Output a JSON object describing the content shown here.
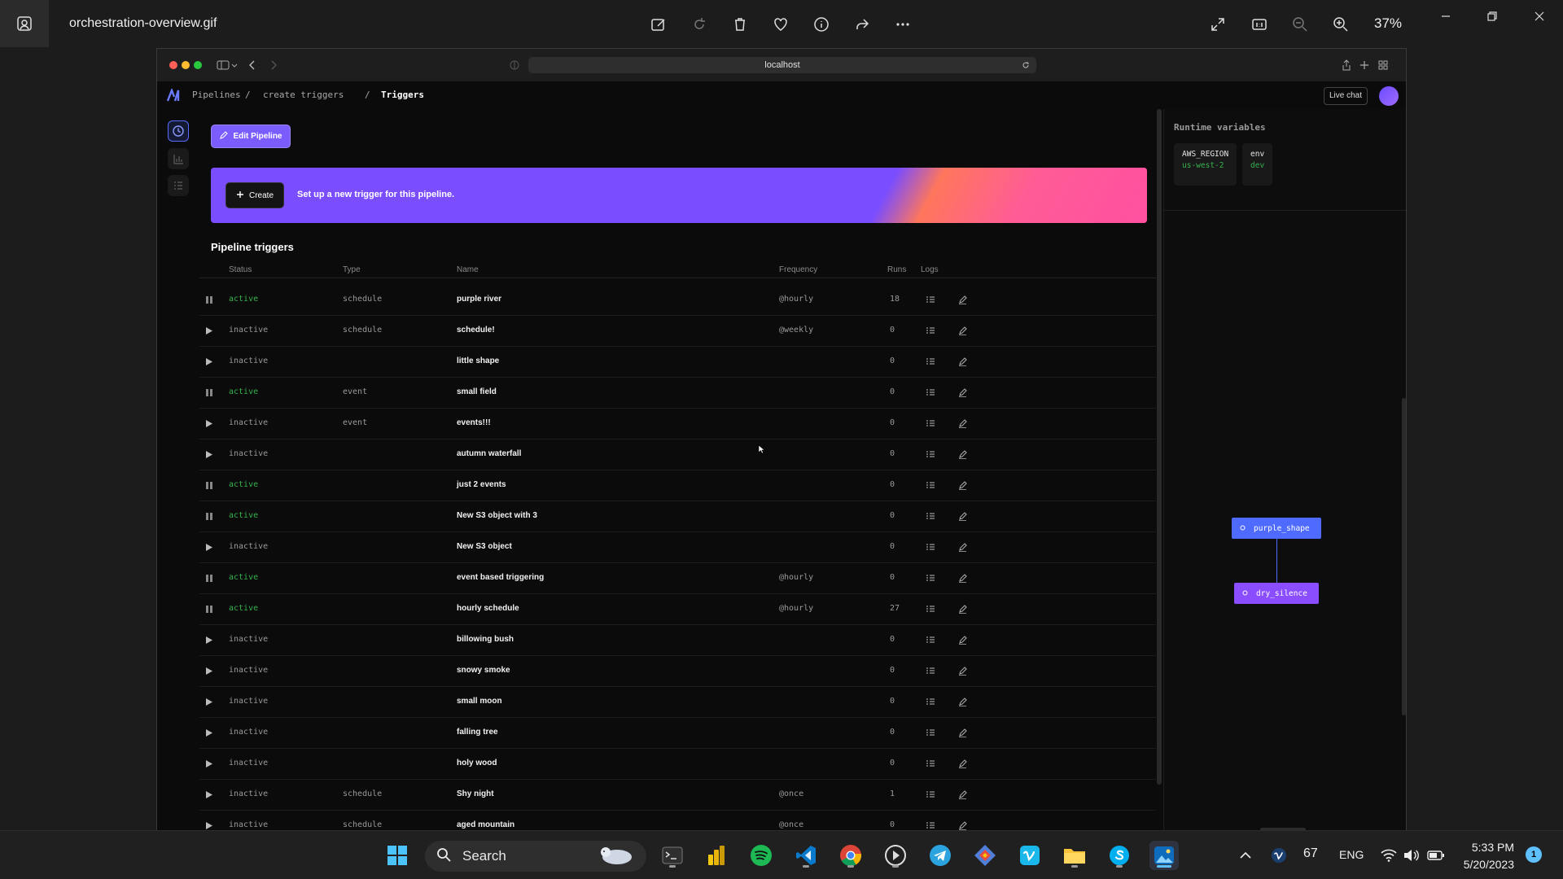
{
  "viewer": {
    "filename": "orchestration-overview.gif",
    "zoom": "37%",
    "toolbar": [
      "edit-image-icon",
      "rotate-icon",
      "delete-icon",
      "favorite-icon",
      "info-icon",
      "share-icon",
      "more-icon"
    ],
    "right_tools": [
      "fullscreen-icon",
      "actual-size-icon",
      "zoom-out-icon",
      "zoom-in-icon"
    ]
  },
  "browser": {
    "url": "localhost"
  },
  "app": {
    "breadcrumbs": [
      "Pipelines",
      "create triggers",
      "Triggers"
    ],
    "live_chat": "Live chat",
    "edit_pipeline": "Edit Pipeline",
    "create_label": "Create",
    "banner_text": "Set up a new trigger for this pipeline.",
    "section_title": "Pipeline triggers",
    "columns": {
      "status": "Status",
      "type": "Type",
      "name": "Name",
      "frequency": "Frequency",
      "runs": "Runs",
      "logs": "Logs"
    },
    "triggers": [
      {
        "status": "active",
        "type": "schedule",
        "name": "purple river",
        "frequency": "@hourly",
        "runs": "18"
      },
      {
        "status": "inactive",
        "type": "schedule",
        "name": "schedule!",
        "frequency": "@weekly",
        "runs": "0"
      },
      {
        "status": "inactive",
        "type": "",
        "name": "little shape",
        "frequency": "",
        "runs": "0"
      },
      {
        "status": "active",
        "type": "event",
        "name": "small field",
        "frequency": "",
        "runs": "0"
      },
      {
        "status": "inactive",
        "type": "event",
        "name": "events!!!",
        "frequency": "",
        "runs": "0"
      },
      {
        "status": "inactive",
        "type": "",
        "name": "autumn waterfall",
        "frequency": "",
        "runs": "0"
      },
      {
        "status": "active",
        "type": "",
        "name": "just 2 events",
        "frequency": "",
        "runs": "0"
      },
      {
        "status": "active",
        "type": "",
        "name": "New S3 object with 3",
        "frequency": "",
        "runs": "0"
      },
      {
        "status": "inactive",
        "type": "",
        "name": "New S3 object",
        "frequency": "",
        "runs": "0"
      },
      {
        "status": "active",
        "type": "",
        "name": "event based triggering",
        "frequency": "@hourly",
        "runs": "0"
      },
      {
        "status": "active",
        "type": "",
        "name": "hourly schedule",
        "frequency": "@hourly",
        "runs": "27"
      },
      {
        "status": "inactive",
        "type": "",
        "name": "billowing bush",
        "frequency": "",
        "runs": "0"
      },
      {
        "status": "inactive",
        "type": "",
        "name": "snowy smoke",
        "frequency": "",
        "runs": "0"
      },
      {
        "status": "inactive",
        "type": "",
        "name": "small moon",
        "frequency": "",
        "runs": "0"
      },
      {
        "status": "inactive",
        "type": "",
        "name": "falling tree",
        "frequency": "",
        "runs": "0"
      },
      {
        "status": "inactive",
        "type": "",
        "name": "holy wood",
        "frequency": "",
        "runs": "0"
      },
      {
        "status": "inactive",
        "type": "schedule",
        "name": "Shy night",
        "frequency": "@once",
        "runs": "1"
      },
      {
        "status": "inactive",
        "type": "schedule",
        "name": "aged mountain",
        "frequency": "@once",
        "runs": "0"
      }
    ],
    "runtime_title": "Runtime variables",
    "variables": [
      {
        "key": "AWS_REGION",
        "value": "us-west-2"
      },
      {
        "key": "env",
        "value": "dev"
      }
    ],
    "blocks": [
      "purple_shape",
      "dry_silence"
    ],
    "colors": {
      "accent": "#7b5cff",
      "active": "#37b24d",
      "block_a": "#4f6bff",
      "block_b": "#8a4dff"
    }
  },
  "taskbar": {
    "search": "Search",
    "temperature": "67",
    "language": "ENG",
    "time": "5:33 PM",
    "date": "5/20/2023",
    "notifications": "1"
  }
}
